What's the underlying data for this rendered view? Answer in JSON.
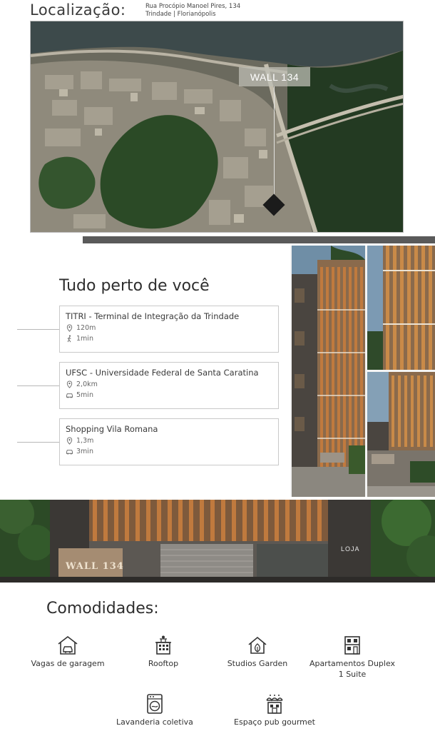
{
  "location": {
    "title": "Localização:",
    "address_line1": "Rua Procópio Manoel Pires, 134",
    "address_line2": "Trindade | Florianópolis",
    "marker_label": "WALL 134"
  },
  "nearby": {
    "title": "Tudo perto de você",
    "places": [
      {
        "name": "TITRI - Terminal de Integração da Trindade",
        "distance": "120m",
        "time": "1min",
        "time_icon": "walk-icon"
      },
      {
        "name": "UFSC - Universidade Federal de Santa Caratina",
        "distance": "2,0km",
        "time": "5min",
        "time_icon": "car-icon"
      },
      {
        "name": "Shopping Vila Romana",
        "distance": "1,3m",
        "time": "3min",
        "time_icon": "car-icon"
      }
    ]
  },
  "building_signs": {
    "facade_sign": "WALL 134",
    "shop_sign": "LOJA"
  },
  "amenities": {
    "title": "Comodidades:",
    "items": [
      {
        "label": "Vagas de garagem",
        "icon": "garage-icon"
      },
      {
        "label": "Rooftop",
        "icon": "rooftop-icon"
      },
      {
        "label": "Studios Garden",
        "icon": "garden-house-icon"
      },
      {
        "label": "Apartamentos Duplex 1 Suite",
        "icon": "duplex-icon"
      },
      {
        "label": "Lavanderia coletiva",
        "icon": "washing-machine-icon"
      },
      {
        "label": "Espaço pub gourmet",
        "icon": "pub-icon"
      }
    ]
  },
  "colors": {
    "text_dark": "#2e2e2e",
    "wood": "#b0703a",
    "facade": "#3e3b37",
    "forest": "#2f4a28"
  }
}
